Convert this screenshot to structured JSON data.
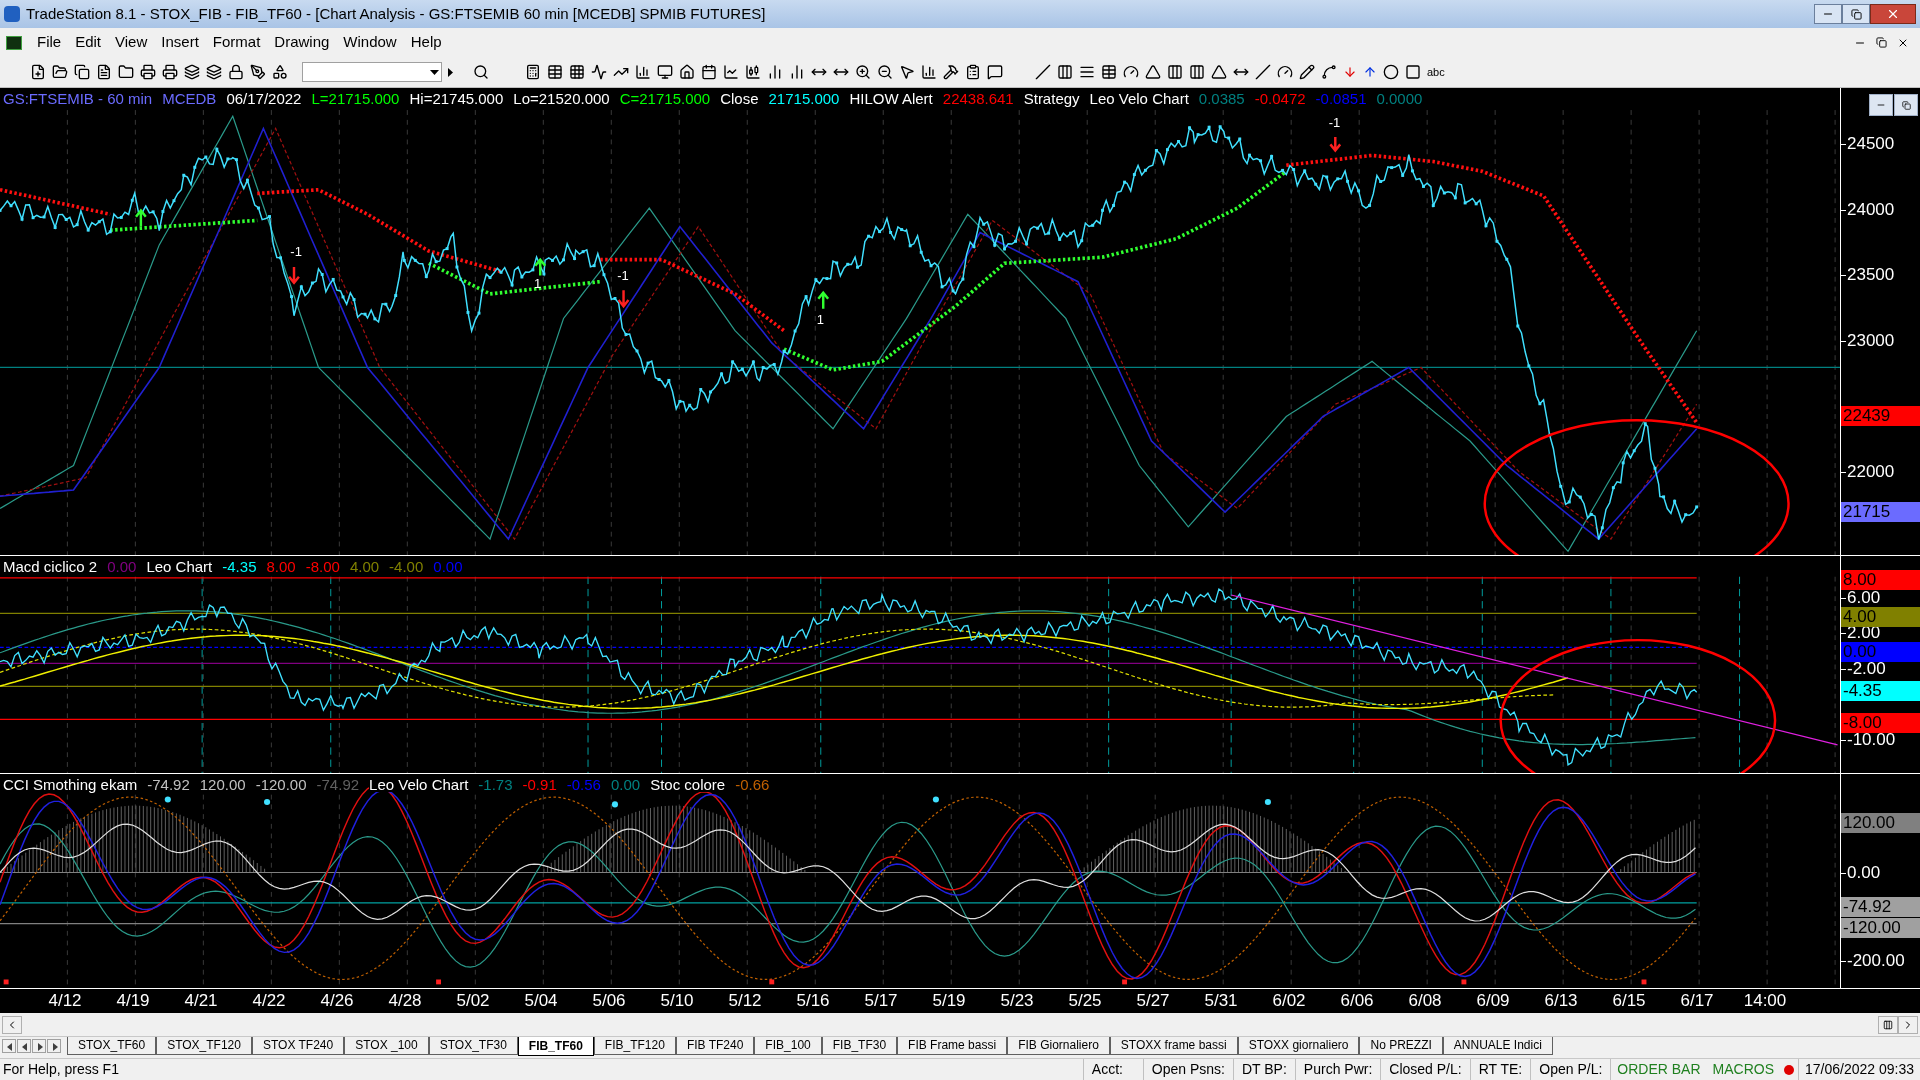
{
  "window": {
    "title": "TradeStation 8.1 - STOX_FIB - FIB_TF60 - [Chart Analysis - GS:FTSEMIB  60 min  [MCEDB] SPMIB FUTURES]"
  },
  "menu": [
    "File",
    "Edit",
    "View",
    "Insert",
    "Format",
    "Drawing",
    "Window",
    "Help"
  ],
  "toolbar": {
    "text_tool": "abc"
  },
  "price_pane": {
    "legend": [
      {
        "text": "GS:FTSEMIB - 60 min",
        "color": "#6b6bff"
      },
      {
        "text": "MCEDB",
        "color": "#6b6bff"
      },
      {
        "text": "06/17/2022",
        "color": "#ffffff"
      },
      {
        "text": "L=21715.000",
        "color": "#00ff00"
      },
      {
        "text": "Hi=21745.000",
        "color": "#ffffff"
      },
      {
        "text": "Lo=21520.000",
        "color": "#ffffff"
      },
      {
        "text": "C=21715.000",
        "color": "#00ff00"
      },
      {
        "text": "Close",
        "color": "#ffffff"
      },
      {
        "text": "21715.000",
        "color": "#00ffff"
      },
      {
        "text": "HILOW Alert",
        "color": "#ffffff"
      },
      {
        "text": "22438.641",
        "color": "#ff0000"
      },
      {
        "text": "Strategy",
        "color": "#ffffff"
      },
      {
        "text": "Leo Velo Chart",
        "color": "#ffffff"
      },
      {
        "text": "0.0385",
        "color": "#008080"
      },
      {
        "text": "-0.0472",
        "color": "#ff0000"
      },
      {
        "text": "-0.0851",
        "color": "#0000ff"
      },
      {
        "text": "0.0000",
        "color": "#008080"
      }
    ],
    "annotations": [
      "-1",
      "-1",
      "-1",
      "1",
      "1"
    ],
    "axis": [
      "24500",
      "24000",
      "23500",
      "23000",
      "22000"
    ],
    "markers": [
      {
        "text": "22439",
        "color": "#ff0000"
      },
      {
        "text": "21715",
        "color": "#6b6bff"
      }
    ]
  },
  "macd_pane": {
    "legend": [
      {
        "text": "Macd ciclico 2",
        "color": "#ffffff"
      },
      {
        "text": "0.00",
        "color": "#800080"
      },
      {
        "text": "Leo Chart",
        "color": "#ffffff"
      },
      {
        "text": "-4.35",
        "color": "#00ffff"
      },
      {
        "text": "8.00",
        "color": "#ff0000"
      },
      {
        "text": "-8.00",
        "color": "#ff0000"
      },
      {
        "text": "4.00",
        "color": "#808000"
      },
      {
        "text": "-4.00",
        "color": "#808000"
      },
      {
        "text": "0.00",
        "color": "#0000ff"
      }
    ],
    "axis": [
      "6.00",
      "2.00",
      "-2.00",
      "-10.00"
    ],
    "markers": [
      {
        "text": "8.00",
        "color": "#ff0000"
      },
      {
        "text": "4.00",
        "color": "#808000"
      },
      {
        "text": "0.00",
        "color": "#0000ff"
      },
      {
        "text": "-4.35",
        "color": "#00ffff"
      },
      {
        "text": "-8.00",
        "color": "#ff0000"
      }
    ]
  },
  "cci_pane": {
    "legend": [
      {
        "text": "CCI Smothing ekam",
        "color": "#ffffff"
      },
      {
        "text": "-74.92",
        "color": "#c0c0c0"
      },
      {
        "text": "120.00",
        "color": "#c0c0c0"
      },
      {
        "text": "-120.00",
        "color": "#c0c0c0"
      },
      {
        "text": "-74.92",
        "color": "#606060"
      },
      {
        "text": "Leo Velo Chart",
        "color": "#ffffff"
      },
      {
        "text": "-1.73",
        "color": "#008080"
      },
      {
        "text": "-0.91",
        "color": "#ff0000"
      },
      {
        "text": "-0.56",
        "color": "#0000ff"
      },
      {
        "text": "0.00",
        "color": "#008080"
      },
      {
        "text": "Stoc colore",
        "color": "#ffffff"
      },
      {
        "text": "-0.66",
        "color": "#c06000"
      }
    ],
    "axis": [
      "0.00",
      "-200.00"
    ],
    "markers": [
      {
        "text": "120.00",
        "color": "#808080"
      },
      {
        "text": "-74.92",
        "color": "#a0a0a0"
      },
      {
        "text": "-120.00",
        "color": "#a0a0a0"
      }
    ]
  },
  "date_axis": [
    "4/12",
    "4/19",
    "4/21",
    "4/22",
    "4/26",
    "4/28",
    "5/02",
    "5/04",
    "5/06",
    "5/10",
    "5/12",
    "5/16",
    "5/17",
    "5/19",
    "5/23",
    "5/25",
    "5/27",
    "5/31",
    "6/02",
    "6/06",
    "6/08",
    "6/09",
    "6/13",
    "6/15",
    "6/17",
    "14:00"
  ],
  "sheet_tabs": [
    {
      "label": "STOX_TF60",
      "selected": false
    },
    {
      "label": "STOX_TF120",
      "selected": false
    },
    {
      "label": "STOX TF240",
      "selected": false
    },
    {
      "label": "STOX _100",
      "selected": false
    },
    {
      "label": "STOX_TF30",
      "selected": false
    },
    {
      "label": "FIB_TF60",
      "selected": true
    },
    {
      "label": "FIB_TF120",
      "selected": false
    },
    {
      "label": "FIB TF240",
      "selected": false
    },
    {
      "label": "FIB_100",
      "selected": false
    },
    {
      "label": "FIB_TF30",
      "selected": false
    },
    {
      "label": "FIB Frame bassi",
      "selected": false
    },
    {
      "label": "FIB Giornaliero",
      "selected": false
    },
    {
      "label": "STOXX frame bassi",
      "selected": false
    },
    {
      "label": "STOXX giornaliero",
      "selected": false
    },
    {
      "label": "No PREZZI",
      "selected": false
    },
    {
      "label": "ANNUALE Indici",
      "selected": false
    }
  ],
  "status_bar": {
    "help": "For Help, press F1",
    "fields": [
      "Acct:",
      "Open Psns:",
      "DT BP:",
      "Purch Pwr:",
      "Closed P/L:",
      "RT TE:",
      "Open P/L:"
    ],
    "order_bar": "ORDER BAR",
    "macros": "MACROS",
    "datetime": "17/06/2022 09:33"
  }
}
